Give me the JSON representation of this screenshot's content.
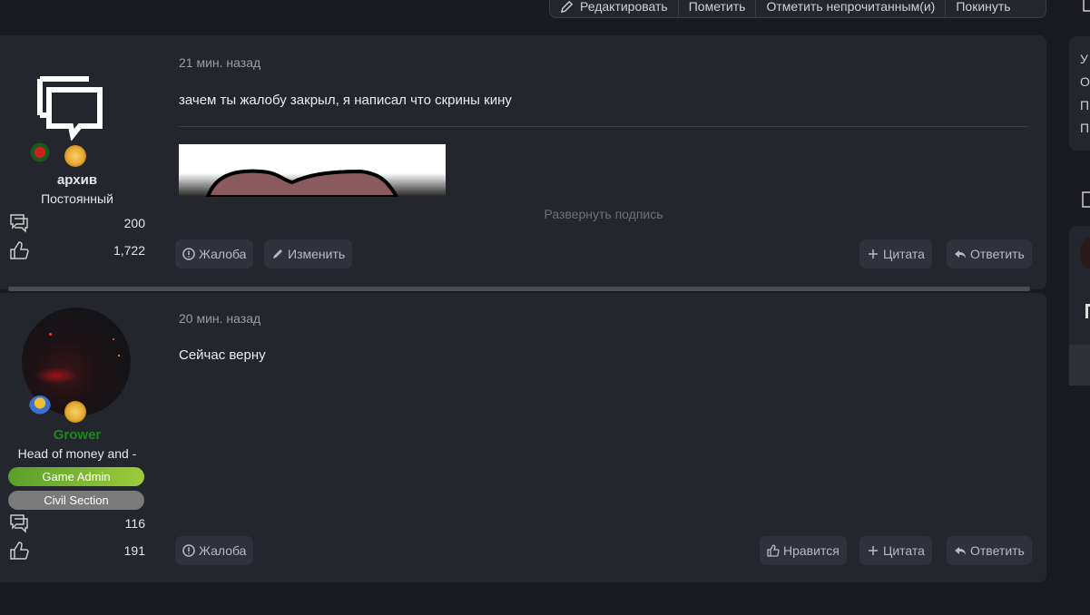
{
  "toolbar": {
    "edit_label": "Редактировать",
    "mark_label": "Пометить",
    "mark_unread_label": "Отметить непрочитанным(и)",
    "leave_label": "Покинуть"
  },
  "sidebar": {
    "letters": [
      "У",
      "О",
      "П",
      "П"
    ]
  },
  "posts": [
    {
      "time": "21 мин. назад",
      "body": "зачем ты жалобу закрыл, я написал что скрины кину",
      "expand_signature": "Развернуть подпись",
      "author": {
        "name": "архив",
        "title": "Постоянный",
        "messages": "200",
        "reactions": "1,722",
        "name_color": "#e6e6e6"
      },
      "actions": {
        "report": "Жалоба",
        "edit": "Изменить",
        "quote": "Цитата",
        "reply": "Ответить"
      }
    },
    {
      "time": "20 мин. назад",
      "body": "Сейчас верну",
      "author": {
        "name": "Grower",
        "title": "Head of money and -",
        "groups": [
          "Game Admin",
          "Civil Section"
        ],
        "messages": "116",
        "reactions": "191",
        "name_color": "#1a8a1a"
      },
      "actions": {
        "report": "Жалоба",
        "like": "Нравится",
        "quote": "Цитата",
        "reply": "Ответить"
      }
    }
  ],
  "colors": {
    "background": "#1a1b22",
    "card": "#24262e",
    "game_admin_gradient": [
      "#5a9e2a",
      "#9ccc3c"
    ],
    "civil_section": "#7a7a7a"
  }
}
